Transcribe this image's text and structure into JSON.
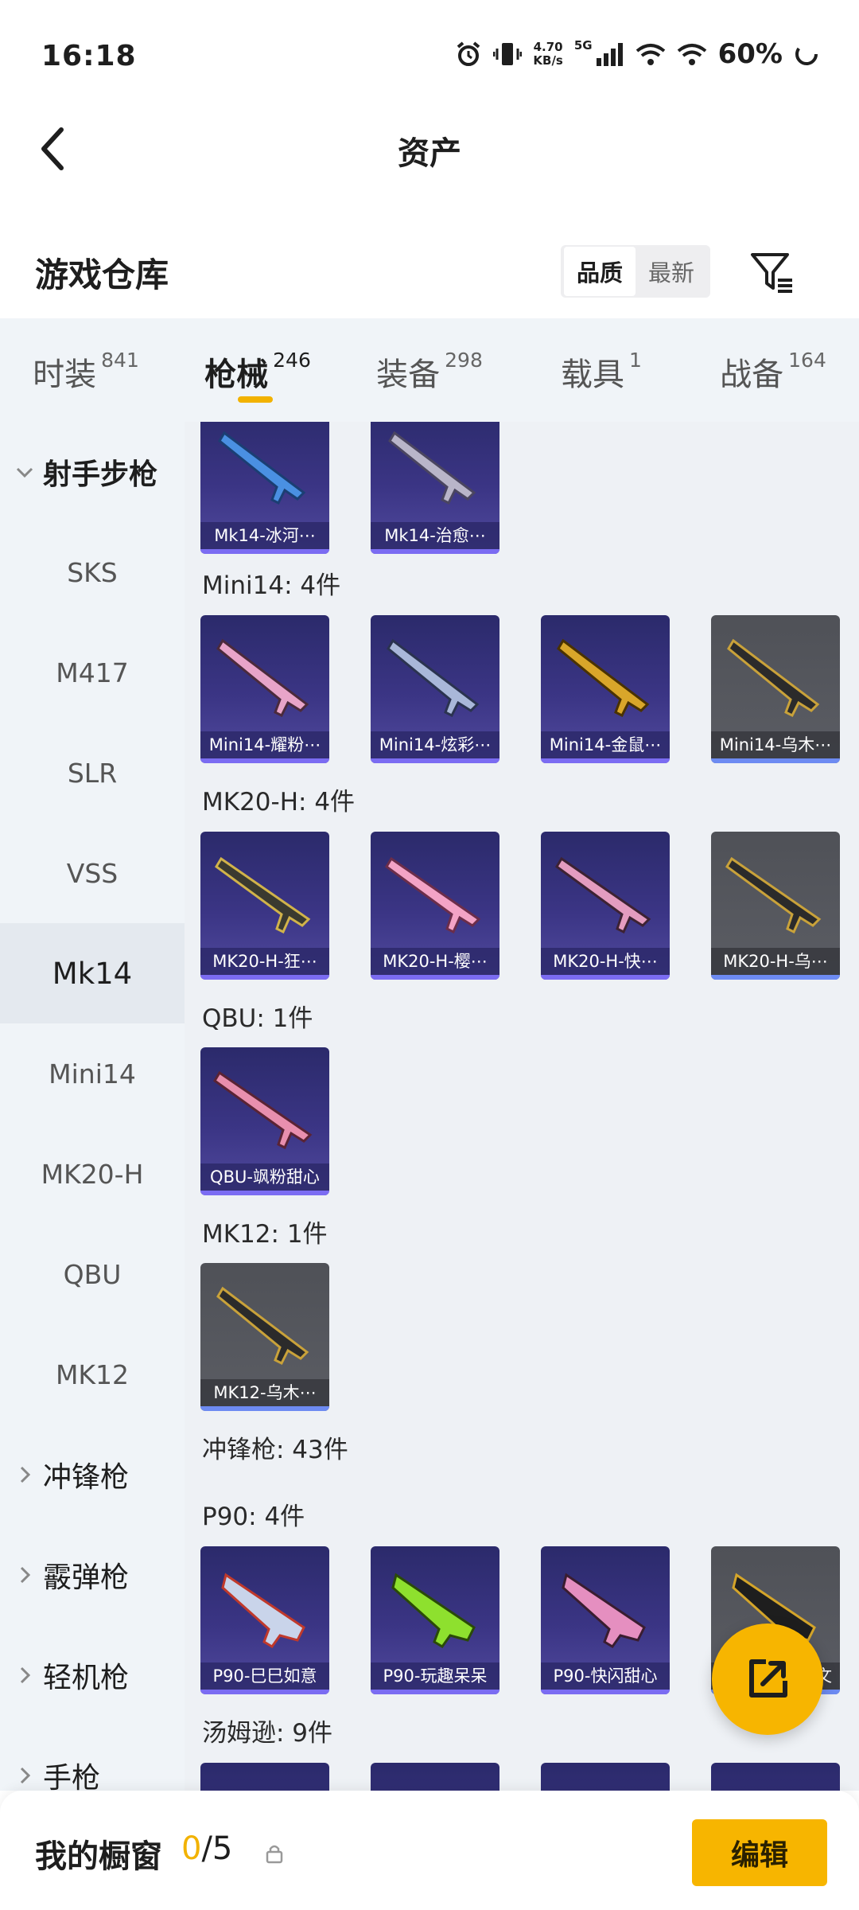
{
  "status_bar": {
    "time": "16:18",
    "net_speed_value": "4.70",
    "net_speed_unit": "KB/s",
    "network": "5G",
    "battery": "60%"
  },
  "header": {
    "title": "资产"
  },
  "warehouse": {
    "title": "游戏仓库",
    "sort_options": [
      "品质",
      "最新"
    ],
    "active_sort": "品质"
  },
  "tabs": [
    {
      "label": "时装",
      "count": "841"
    },
    {
      "label": "枪械",
      "count": "246"
    },
    {
      "label": "装备",
      "count": "298"
    },
    {
      "label": "载具",
      "count": "1"
    },
    {
      "label": "战备",
      "count": "164"
    }
  ],
  "active_tab": "枪械",
  "sidebar": {
    "group_expanded": "射手步枪",
    "items": [
      "SKS",
      "M417",
      "SLR",
      "VSS",
      "Mk14",
      "Mini14",
      "MK20-H",
      "QBU",
      "MK12"
    ],
    "selected": "Mk14",
    "collapsed_groups": [
      "冲锋枪",
      "霰弹枪",
      "轻机枪",
      "手枪"
    ]
  },
  "content": {
    "mk14_items": [
      "Mk14-冰河⋯",
      "Mk14-治愈⋯"
    ],
    "mini14_label": "Mini14: 4件",
    "mini14_items": [
      "Mini14-耀粉⋯",
      "Mini14-炫彩⋯",
      "Mini14-金鼠⋯",
      "Mini14-乌木⋯"
    ],
    "mk20h_label": "MK20-H: 4件",
    "mk20h_items": [
      "MK20-H-狂⋯",
      "MK20-H-樱⋯",
      "MK20-H-快⋯",
      "MK20-H-乌⋯"
    ],
    "qbu_label": "QBU: 1件",
    "qbu_items": [
      "QBU-飒粉甜心"
    ],
    "mk12_label": "MK12: 1件",
    "mk12_items": [
      "MK12-乌木⋯"
    ],
    "smg_label": "冲锋枪: 43件",
    "p90_label": "P90: 4件",
    "p90_items": [
      "P90-巳巳如意",
      "P90-玩趣呆呆",
      "P90-快闪甜心",
      "文"
    ],
    "thompson_label": "汤姆逊: 9件"
  },
  "bottom_bar": {
    "title": "我的橱窗",
    "current": "0",
    "total": "/5",
    "edit_label": "编辑"
  },
  "colors": {
    "accent": "#f7b500",
    "card_purple": "#3b3585",
    "card_grey": "#55575d",
    "sidebar_bg": "#f0f4f8"
  }
}
